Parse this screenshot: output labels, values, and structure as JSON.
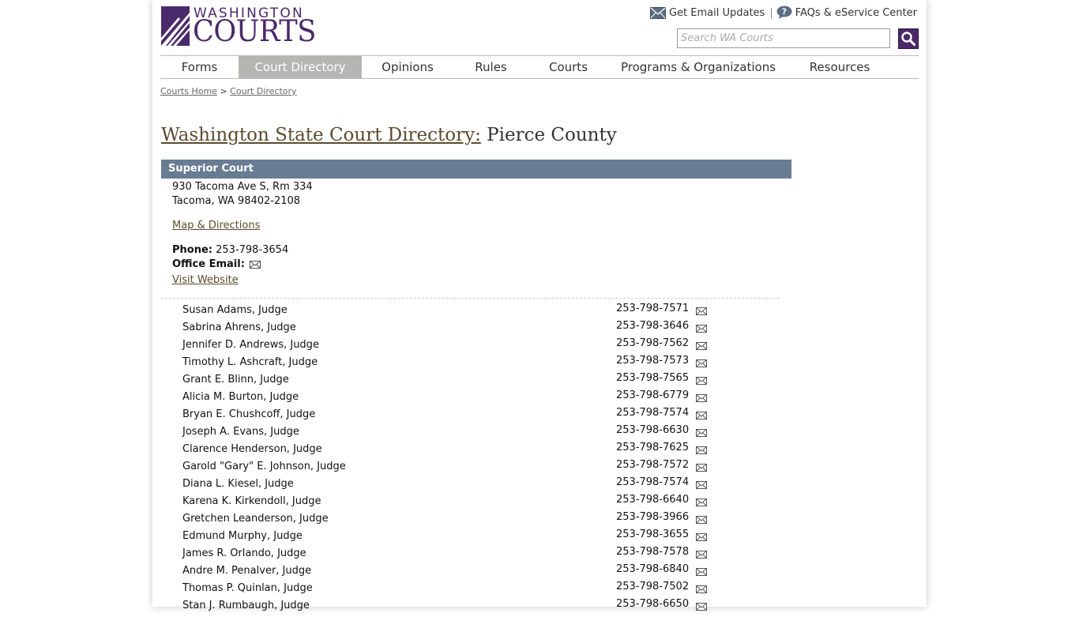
{
  "header": {
    "logo_top": "WASHINGTON",
    "logo_bottom": "COURTS",
    "email_updates_label": "Get Email Updates",
    "separator": "|",
    "faqs_label": "FAQs & eService Center"
  },
  "search": {
    "placeholder": "Search WA Courts",
    "value": ""
  },
  "nav": {
    "items": [
      {
        "label": "Forms"
      },
      {
        "label": "Court Directory",
        "active": true
      },
      {
        "label": "Opinions"
      },
      {
        "label": "Rules"
      },
      {
        "label": "Courts"
      },
      {
        "label": "Programs & Organizations"
      },
      {
        "label": "Resources"
      }
    ]
  },
  "breadcrumb": {
    "home": "Courts Home",
    "separator": ">",
    "current": "Court Directory"
  },
  "page": {
    "title_link": "Washington State Court Directory:",
    "title_rest": " Pierce County"
  },
  "court": {
    "name": "Superior Court",
    "address1": "930 Tacoma Ave S, Rm 334",
    "address2": "Tacoma, WA 98402-2108",
    "map_link": "Map & Directions",
    "phone_label": "Phone:",
    "phone": "253-798-3654",
    "office_email_label": "Office Email:",
    "website_link": "Visit Website"
  },
  "judges": [
    {
      "name": "Susan Adams, Judge",
      "phone": "253-798-7571"
    },
    {
      "name": "Sabrina Ahrens, Judge",
      "phone": "253-798-3646"
    },
    {
      "name": "Jennifer D. Andrews, Judge",
      "phone": "253-798-7562"
    },
    {
      "name": "Timothy L. Ashcraft, Judge",
      "phone": "253-798-7573"
    },
    {
      "name": "Grant E. Blinn, Judge",
      "phone": "253-798-7565"
    },
    {
      "name": "Alicia M. Burton, Judge",
      "phone": "253-798-6779"
    },
    {
      "name": "Bryan E. Chushcoff, Judge",
      "phone": "253-798-7574"
    },
    {
      "name": "Joseph A. Evans, Judge",
      "phone": "253-798-6630"
    },
    {
      "name": "Clarence Henderson, Judge",
      "phone": "253-798-7625"
    },
    {
      "name": "Garold \"Gary\" E. Johnson, Judge",
      "phone": "253-798-7572"
    },
    {
      "name": "Diana L. Kiesel, Judge",
      "phone": "253-798-7574"
    },
    {
      "name": "Karena K. Kirkendoll, Judge",
      "phone": "253-798-6640"
    },
    {
      "name": "Gretchen Leanderson, Judge",
      "phone": "253-798-3966"
    },
    {
      "name": "Edmund Murphy, Judge",
      "phone": "253-798-3655"
    },
    {
      "name": "James R. Orlando, Judge",
      "phone": "253-798-7578"
    },
    {
      "name": "Andre M. Penalver, Judge",
      "phone": "253-798-6840"
    },
    {
      "name": "Thomas P. Quinlan, Judge",
      "phone": "253-798-7502"
    },
    {
      "name": "Stan J. Rumbaugh, Judge",
      "phone": "253-798-6650"
    }
  ],
  "colors": {
    "brand_purple": "#4a2a6a",
    "court_header": "#687c93",
    "nav_active": "#b5b6b1"
  },
  "icons": {
    "email": "envelope-icon",
    "help": "question-icon",
    "search": "magnifier-icon"
  }
}
